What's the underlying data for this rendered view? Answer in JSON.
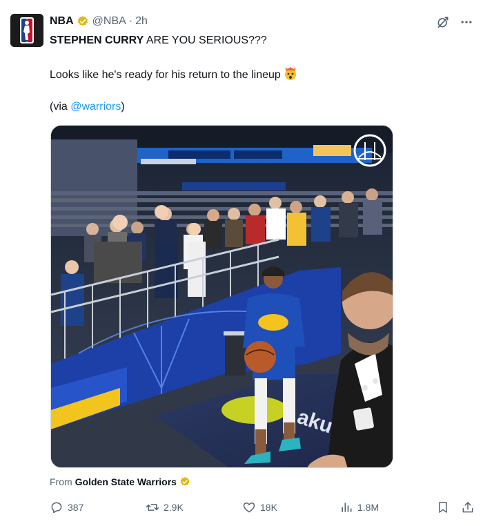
{
  "post": {
    "author_name": "NBA",
    "handle": "@NBA",
    "separator": "·",
    "time": "2h",
    "line1_bold": "STEPHEN CURRY",
    "line1_rest": " ARE YOU SERIOUS???",
    "line2": "Looks like he's ready for his return to the lineup",
    "line3_prefix": "(via ",
    "line3_mention": "@warriors",
    "line3_suffix": ")"
  },
  "media": {
    "icons": [
      "warriors-bridge-logo"
    ]
  },
  "source": {
    "prefix": "From",
    "name": "Golden State Warriors"
  },
  "actions": {
    "replies": "387",
    "reposts": "2.9K",
    "likes": "18K",
    "views": "1.8M"
  },
  "icons": {
    "verified": "verified-gold-badge-icon",
    "grok": "grok-icon",
    "more": "more-icon"
  },
  "colors": {
    "link": "#1d9bf0",
    "muted": "#536471",
    "gold_badge": "#e2b719",
    "nba_blue": "#1d428a",
    "nba_red": "#c8102e"
  }
}
